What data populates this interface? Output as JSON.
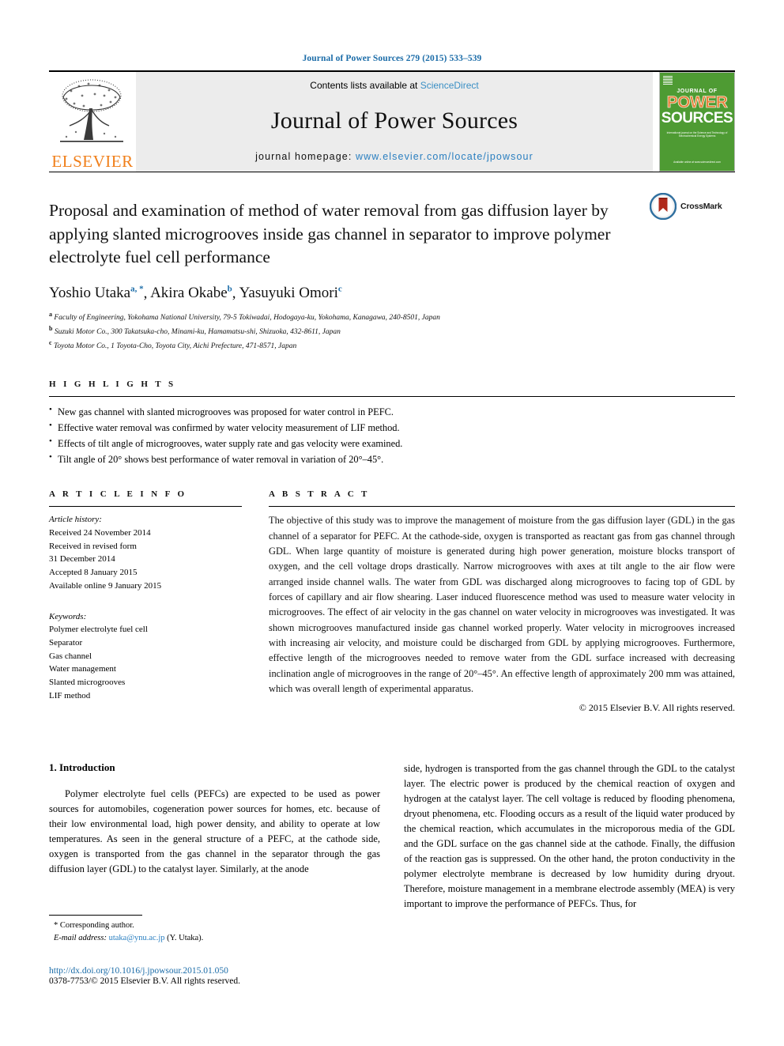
{
  "running_head": "Journal of Power Sources 279 (2015) 533–539",
  "masthead": {
    "contents_prefix": "Contents lists available at ",
    "sciencedirect": "ScienceDirect",
    "journal_title": "Journal of Power Sources",
    "homepage_prefix": "journal homepage: ",
    "homepage_url": "www.elsevier.com/locate/jpowsour",
    "publisher_wordmark": "ELSEVIER",
    "cover": {
      "journal_of": "JOURNAL OF",
      "power": "POWER",
      "sources": "SOURCES",
      "blurb": "International journal on the Science and Technology of Electrochemical Energy Systems",
      "footer": "Available online at www.sciencedirect.com"
    },
    "accent_color": "#2a7fc0",
    "band_color": "#ececec",
    "elsevier_orange": "#f07f1a",
    "cover_green": "#4e9b33"
  },
  "article": {
    "crossmark_label": "CrossMark",
    "title": "Proposal and examination of method of water removal from gas diffusion layer by applying slanted microgrooves inside gas channel in separator to improve polymer electrolyte fuel cell performance",
    "authors": [
      {
        "name": "Yoshio Utaka",
        "marks": "a, *"
      },
      {
        "name": "Akira Okabe",
        "marks": "b"
      },
      {
        "name": "Yasuyuki Omori",
        "marks": "c"
      }
    ],
    "affiliations": [
      {
        "mark": "a",
        "text": "Faculty of Engineering, Yokohama National University, 79-5 Tokiwadai, Hodogaya-ku, Yokohama, Kanagawa, 240-8501, Japan"
      },
      {
        "mark": "b",
        "text": "Suzuki Motor Co., 300 Takatsuka-cho, Minami-ku, Hamamatsu-shi, Shizuoka, 432-8611, Japan"
      },
      {
        "mark": "c",
        "text": "Toyota Motor Co., 1 Toyota-Cho, Toyota City, Aichi Prefecture, 471-8571, Japan"
      }
    ]
  },
  "highlights": {
    "heading": "H I G H L I G H T S",
    "items": [
      "New gas channel with slanted microgrooves was proposed for water control in PEFC.",
      "Effective water removal was confirmed by water velocity measurement of LIF method.",
      "Effects of tilt angle of microgrooves, water supply rate and gas velocity were examined.",
      "Tilt angle of 20° shows best performance of water removal in variation of 20°–45°."
    ]
  },
  "article_info": {
    "heading": "A R T I C L E   I N F O",
    "history_label": "Article history:",
    "history": [
      "Received 24 November 2014",
      "Received in revised form",
      "31 December 2014",
      "Accepted 8 January 2015",
      "Available online 9 January 2015"
    ],
    "keywords_label": "Keywords:",
    "keywords": [
      "Polymer electrolyte fuel cell",
      "Separator",
      "Gas channel",
      "Water management",
      "Slanted microgrooves",
      "LIF method"
    ]
  },
  "abstract": {
    "heading": "A B S T R A C T",
    "text": "The objective of this study was to improve the management of moisture from the gas diffusion layer (GDL) in the gas channel of a separator for PEFC. At the cathode-side, oxygen is transported as reactant gas from gas channel through GDL. When large quantity of moisture is generated during high power generation, moisture blocks transport of oxygen, and the cell voltage drops drastically. Narrow microgrooves with axes at tilt angle to the air flow were arranged inside channel walls. The water from GDL was discharged along microgrooves to facing top of GDL by forces of capillary and air flow shearing. Laser induced fluorescence method was used to measure water velocity in microgrooves. The effect of air velocity in the gas channel on water velocity in microgrooves was investigated. It was shown microgrooves manufactured inside gas channel worked properly. Water velocity in microgrooves increased with increasing air velocity, and moisture could be discharged from GDL by applying microgrooves. Furthermore, effective length of the microgrooves needed to remove water from the GDL surface increased with decreasing inclination angle of microgrooves in the range of 20°–45°. An effective length of approximately 200 mm was attained, which was overall length of experimental apparatus.",
    "copyright": "© 2015 Elsevier B.V. All rights reserved."
  },
  "body": {
    "section_heading": "1. Introduction",
    "left_paragraph": "Polymer electrolyte fuel cells (PEFCs) are expected to be used as power sources for automobiles, cogeneration power sources for homes, etc. because of their low environmental load, high power density, and ability to operate at low temperatures. As seen in the general structure of a PEFC, at the cathode side, oxygen is transported from the gas channel in the separator through the gas diffusion layer (GDL) to the catalyst layer. Similarly, at the anode",
    "right_paragraph": "side, hydrogen is transported from the gas channel through the GDL to the catalyst layer. The electric power is produced by the chemical reaction of oxygen and hydrogen at the catalyst layer. The cell voltage is reduced by flooding phenomena, dryout phenomena, etc. Flooding occurs as a result of the liquid water produced by the chemical reaction, which accumulates in the microporous media of the GDL and the GDL surface on the gas channel side at the cathode. Finally, the diffusion of the reaction gas is suppressed. On the other hand, the proton conductivity in the polymer electrolyte membrane is decreased by low humidity during dryout. Therefore, moisture management in a membrane electrode assembly (MEA) is very important to improve the performance of PEFCs. Thus, for"
  },
  "footnote": {
    "corresponding": "* Corresponding author.",
    "email_label": "E-mail address:",
    "email": "utaka@ynu.ac.jp",
    "email_suffix": "(Y. Utaka)."
  },
  "footer": {
    "doi": "http://dx.doi.org/10.1016/j.jpowsour.2015.01.050",
    "issn_line": "0378-7753/© 2015 Elsevier B.V. All rights reserved."
  }
}
